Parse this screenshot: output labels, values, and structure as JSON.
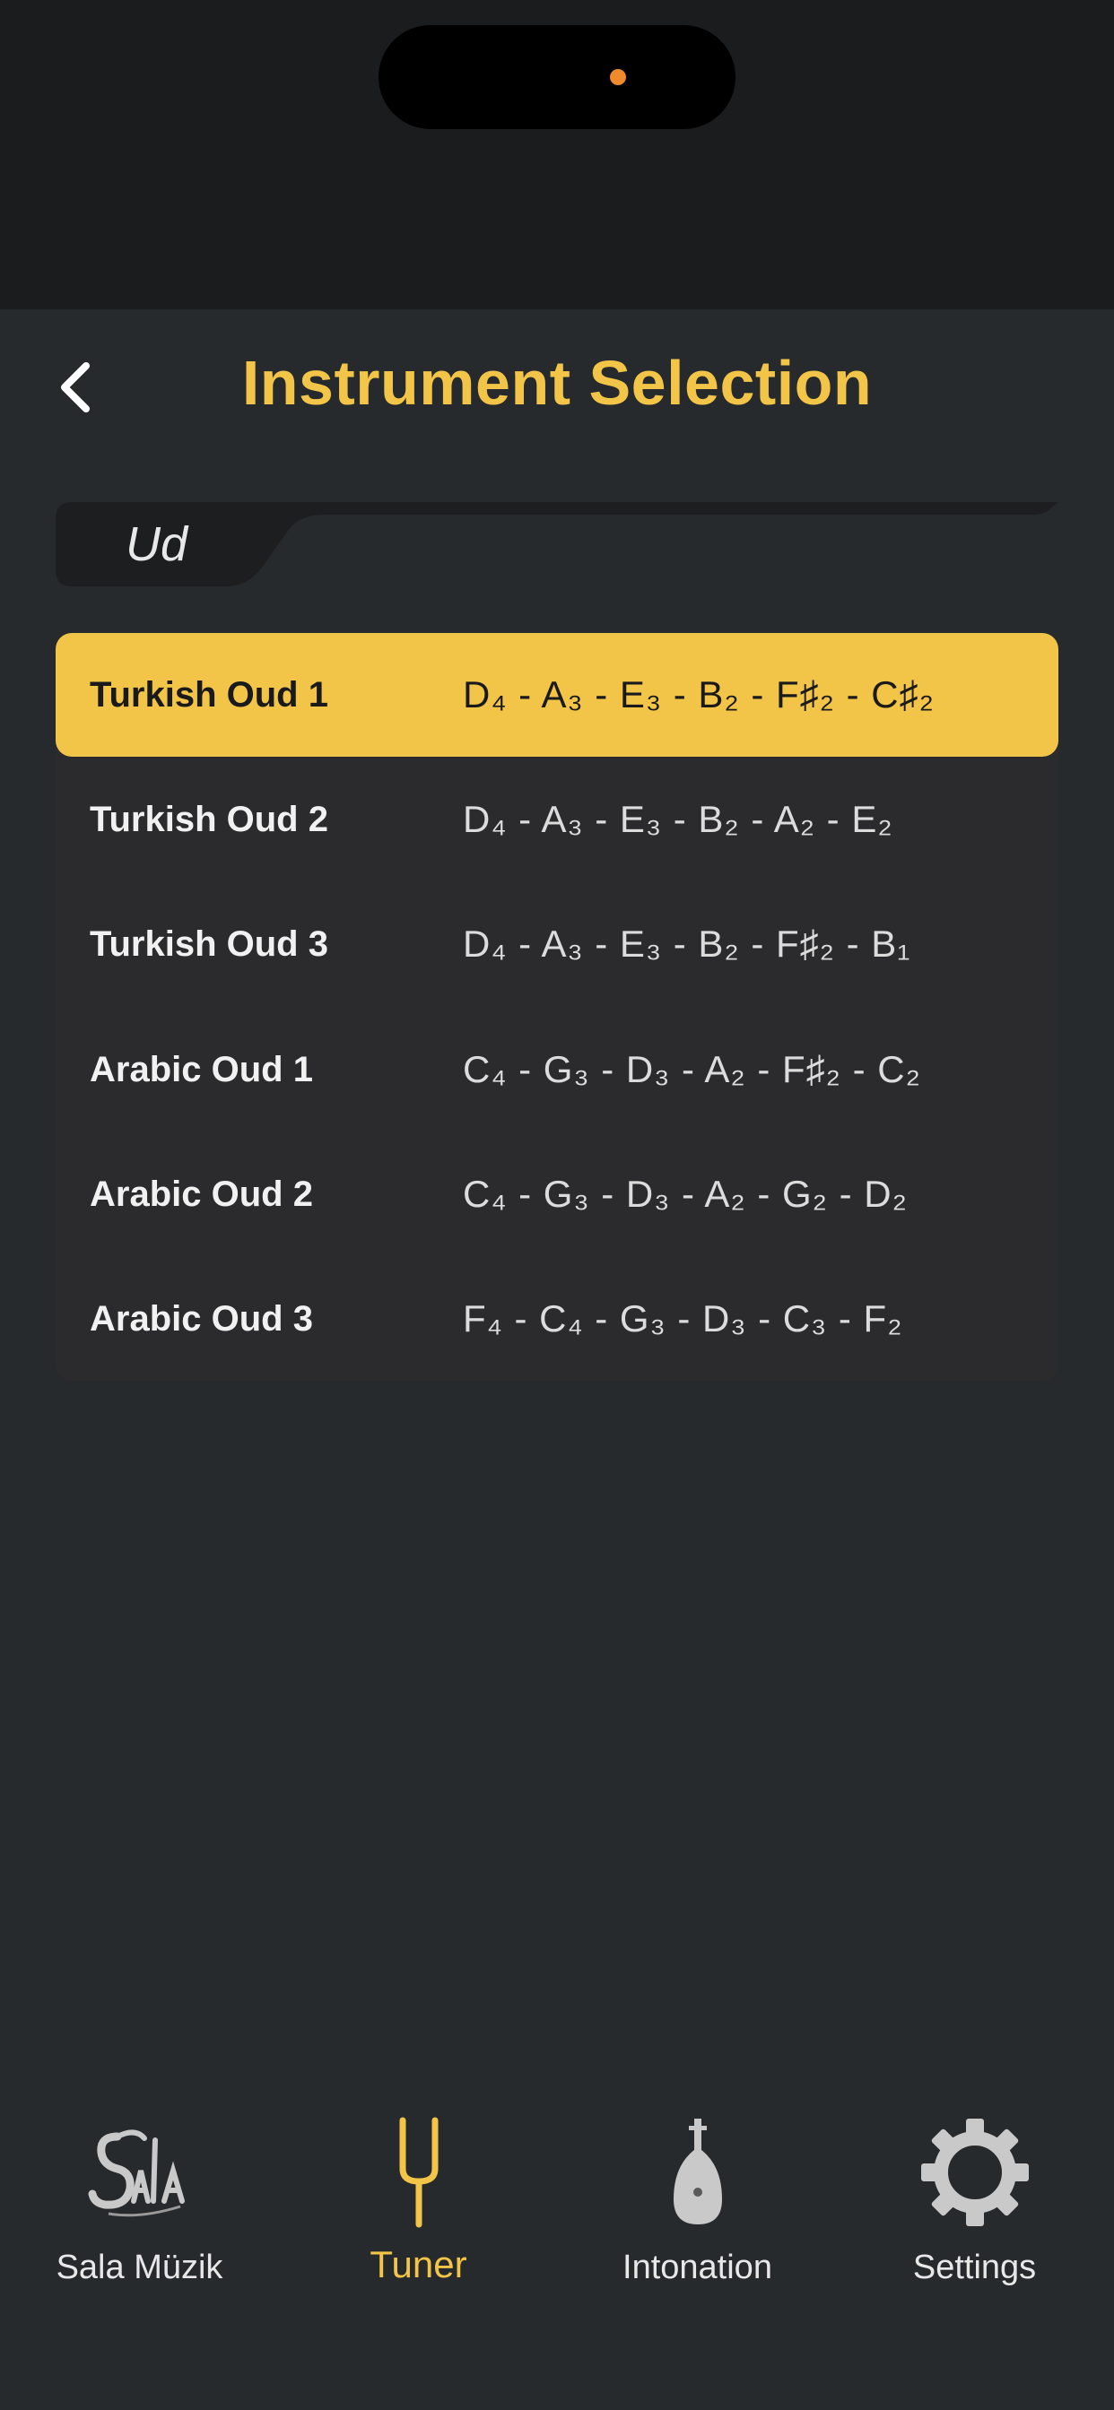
{
  "header": {
    "title": "Instrument Selection"
  },
  "instrument_tab": {
    "label": "Ud"
  },
  "presets": [
    {
      "name": "Turkish Oud 1",
      "notes": "D₄ - A₃ - E₃ - B₂ - F♯₂ - C♯₂",
      "selected": true
    },
    {
      "name": "Turkish Oud 2",
      "notes": "D₄ - A₃ - E₃ - B₂ - A₂ - E₂",
      "selected": false
    },
    {
      "name": "Turkish Oud 3",
      "notes": "D₄ - A₃ - E₃ - B₂ - F♯₂ - B₁",
      "selected": false
    },
    {
      "name": "Arabic Oud 1",
      "notes": "C₄ - G₃ - D₃ - A₂ - F♯₂ - C₂",
      "selected": false
    },
    {
      "name": "Arabic Oud 2",
      "notes": "C₄ - G₃ - D₃ - A₂ - G₂ - D₂",
      "selected": false
    },
    {
      "name": "Arabic Oud 3",
      "notes": "F₄ - C₄ - G₃ - D₃ - C₃ - F₂",
      "selected": false
    }
  ],
  "tabbar": {
    "items": [
      {
        "label": "Sala Müzik",
        "icon": "sala-logo-icon",
        "active": false
      },
      {
        "label": "Tuner",
        "icon": "tuning-fork-icon",
        "active": true
      },
      {
        "label": "Intonation",
        "icon": "oud-icon",
        "active": false
      },
      {
        "label": "Settings",
        "icon": "gear-icon",
        "active": false
      }
    ]
  },
  "colors": {
    "accent": "#f2c548",
    "background": "#272a2c",
    "list_background": "#2b2a2c",
    "status_bar": "#1b1c1e"
  }
}
